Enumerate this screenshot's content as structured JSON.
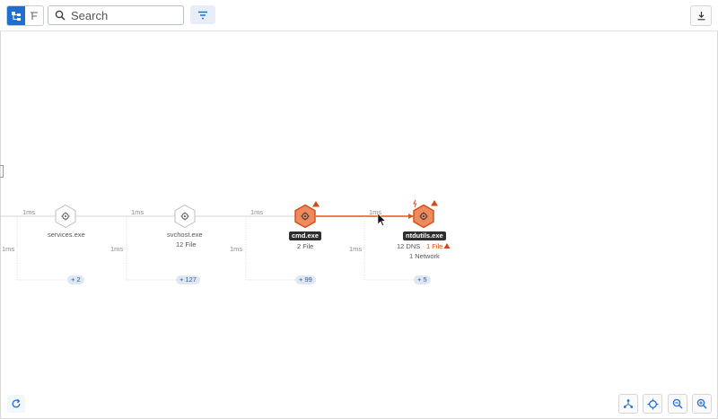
{
  "toolbar": {
    "search": {
      "placeholder": "Search",
      "value": ""
    },
    "view_modes": [
      "graph",
      "tree"
    ],
    "active_view": "graph"
  },
  "graph": {
    "nodes": [
      {
        "name": "services.exe",
        "stats": "",
        "expand": "+ 2",
        "edge_in": "1ms",
        "edge_down": "1ms",
        "state": "normal"
      },
      {
        "name": "svchost.exe",
        "stats": "12 File",
        "expand": "+ 127",
        "edge_in": "1ms",
        "edge_down": "1ms",
        "state": "normal"
      },
      {
        "name": "cmd.exe",
        "stats": "2 File",
        "expand": "+ 99",
        "edge_in": "1ms",
        "edge_down": "1ms",
        "state": "alert"
      },
      {
        "name": "ntdutils.exe",
        "stats_dns": "12 DNS",
        "stats_file": "1 File",
        "stats_network": "1 Network",
        "expand": "+ 5",
        "edge_in": "1ms",
        "edge_down": "1ms",
        "state": "alert"
      }
    ]
  },
  "colors": {
    "accent": "#1f6fd1",
    "alert": "#d24a18",
    "alert_fill": "#ee8a5c",
    "pill_bg": "#dfe7f3"
  },
  "icons": [
    "graph-view-icon",
    "tree-view-icon",
    "search-icon",
    "filter-icon",
    "download-icon",
    "refresh-icon",
    "layout-tree-icon",
    "recenter-icon",
    "zoom-out-icon",
    "zoom-in-icon"
  ]
}
